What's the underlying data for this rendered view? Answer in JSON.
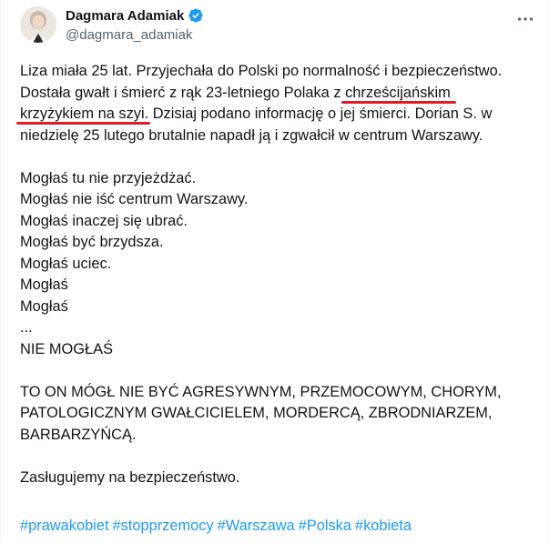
{
  "author": {
    "name": "Dagmara Adamiak",
    "handle": "@dagmara_adamiak",
    "verified_color": "#1d9bf0"
  },
  "tweet": {
    "p1_l1": "Liza miała 25 lat. Przyjechała do Polski po normalność i bezpieczeństwo.",
    "p1_l2a": "Dostała gwałt i śmierć z rąk 23-letniego Polaka z ",
    "p1_l2b": "chrześcijańskim",
    "p1_l3a": "krzyżykiem na szyi",
    "p1_l3b": ". Dzisiaj podano informację o jej śmierci. Dorian S. w",
    "p1_l4": "niedzielę 25 lutego brutalnie napadł ją i zgwałcił w centrum Warszawy.",
    "list": [
      "Mogłaś tu nie przyjeżdżać.",
      "Mogłaś nie iść centrum Warszawy.",
      "Mogłaś inaczej się ubrać.",
      "Mogłaś być brzydsza.",
      "Mogłaś uciec.",
      "Mogłaś",
      "Mogłaś",
      "...",
      "NIE MOGŁAŚ"
    ],
    "caps": [
      "TO ON MÓGŁ NIE BYĆ AGRESYWNYM, PRZEMOCOWYM, CHORYM,",
      "PATOLOGICZNYM GWAŁCICIELEM, MORDERCĄ, ZBRODNIARZEM,",
      "BARBARZYŃCĄ."
    ],
    "closing": "Zasługujemy na bezpieczeństwo.",
    "hashtags": [
      "#prawakobiet",
      "#stopprzemocy",
      "#Warszawa",
      "#Polska",
      "#kobieta"
    ]
  },
  "colors": {
    "underline": "#e01b24",
    "link": "#1d9bf0"
  }
}
